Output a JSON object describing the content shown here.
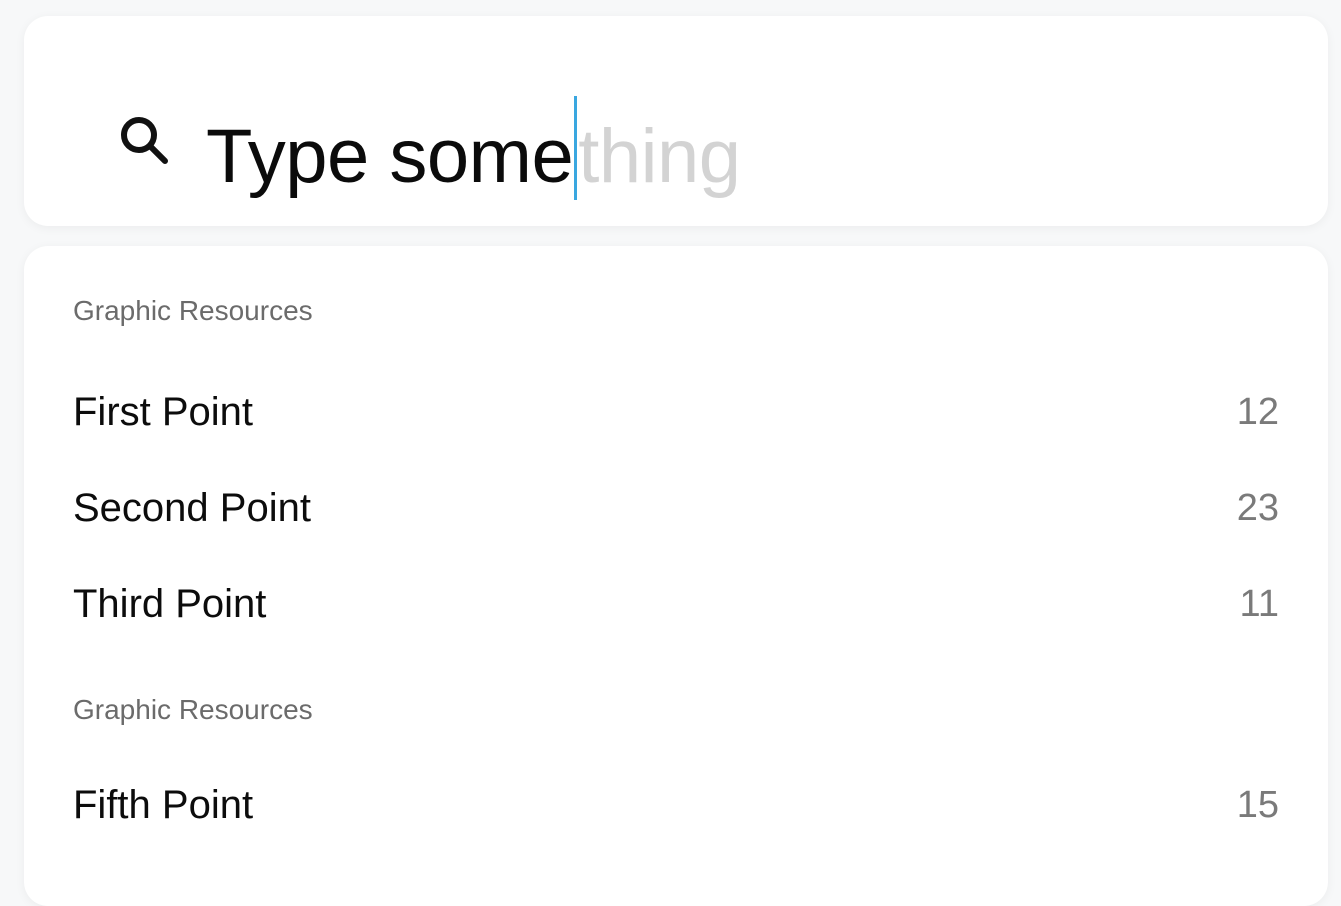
{
  "search": {
    "typed_text": "Type some",
    "suggestion_text": "thing",
    "icon": "search-icon",
    "caret_color": "#3aa7e0"
  },
  "results": {
    "sections": [
      {
        "header": "Graphic Resources",
        "items": [
          {
            "label": "First Point",
            "count": "12"
          },
          {
            "label": "Second Point",
            "count": "23"
          },
          {
            "label": "Third Point",
            "count": "11"
          }
        ]
      },
      {
        "header": "Graphic Resources",
        "items": [
          {
            "label": "Fifth Point",
            "count": "15"
          }
        ]
      }
    ]
  }
}
